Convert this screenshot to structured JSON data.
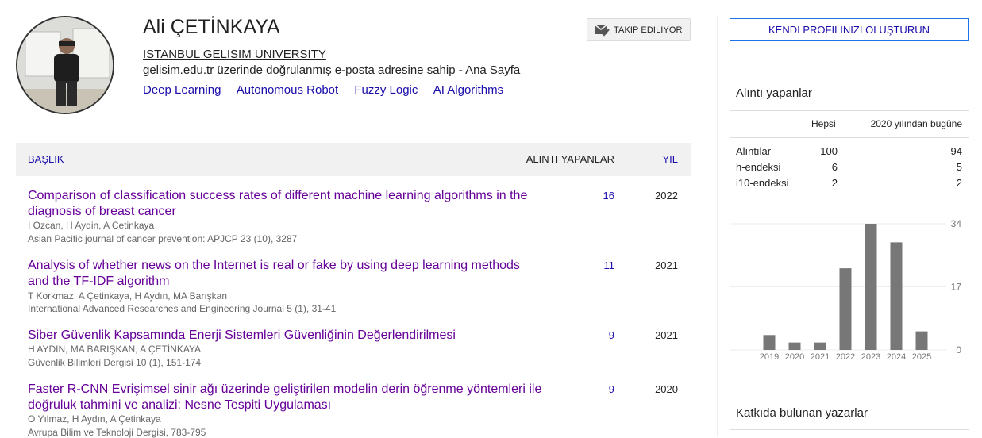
{
  "profile": {
    "name": "Ali ÇETİNKAYA",
    "affiliation": "ISTANBUL GELISIM UNIVERSITY",
    "verified_text": "gelisim.edu.tr üzerinde doğrulanmış e-posta adresine sahip - ",
    "homepage_label": "Ana Sayfa",
    "interests": [
      "Deep Learning",
      "Autonomous Robot",
      "Fuzzy Logic",
      "AI Algorithms"
    ],
    "follow_label": "TAKIP EDILIYOR"
  },
  "table": {
    "header": {
      "title": "BAŞLIK",
      "cited_by": "ALINTI YAPANLAR",
      "year": "YIL"
    },
    "rows": [
      {
        "title": "Comparison of classification success rates of different machine learning algorithms in the diagnosis of breast cancer",
        "authors": "I Ozcan, H Aydin, A Cetinkaya",
        "venue": "Asian Pacific journal of cancer prevention: APJCP 23 (10), 3287",
        "cited": "16",
        "year": "2022"
      },
      {
        "title": "Analysis of whether news on the Internet is real or fake by using deep learning methods and the TF-IDF algorithm",
        "authors": "T Korkmaz, A Çetinkaya, H Aydın, MA Barışkan",
        "venue": "International Advanced Researches and Engineering Journal 5 (1), 31-41",
        "cited": "11",
        "year": "2021"
      },
      {
        "title": "Siber Güvenlik Kapsamında Enerji Sistemleri Güvenliğinin Değerlendirilmesi",
        "authors": "H AYDIN, MA BARIŞKAN, A ÇETİNKAYA",
        "venue": "Güvenlik Bilimleri Dergisi 10 (1), 151-174",
        "cited": "9",
        "year": "2021"
      },
      {
        "title": "Faster R-CNN Evrişimsel sinir ağı üzerinde geliştirilen modelin derin öğrenme yöntemleri ile doğruluk tahmini ve analizi: Nesne Tespiti Uygulaması",
        "authors": "O Yılmaz, H Aydın, A Çetinkaya",
        "venue": "Avrupa Bilim ve Teknoloji Dergisi, 783-795",
        "cited": "9",
        "year": "2020"
      }
    ]
  },
  "sidebar": {
    "create_profile_label": "KENDI PROFILINIZI OLUŞTURUN",
    "cited_by_title": "Alıntı yapanlar",
    "stats_headers": {
      "all": "Hepsi",
      "since": "2020 yılından bugüne"
    },
    "stats": [
      {
        "label": "Alıntılar",
        "all": "100",
        "since": "94"
      },
      {
        "label": "h-endeksi",
        "all": "6",
        "since": "5"
      },
      {
        "label": "i10-endeksi",
        "all": "2",
        "since": "2"
      }
    ],
    "coauthors_title": "Katkıda bulunan yazarlar"
  },
  "colors": {
    "link": "#1a0dab",
    "visited": "#660099",
    "bar": "#777777"
  },
  "chart_data": {
    "type": "bar",
    "categories": [
      "2019",
      "2020",
      "2021",
      "2022",
      "2023",
      "2024",
      "2025"
    ],
    "values": [
      4,
      2,
      2,
      22,
      34,
      29,
      5
    ],
    "y_ticks": [
      "34",
      "17",
      "0"
    ],
    "ylim": [
      0,
      34
    ]
  }
}
